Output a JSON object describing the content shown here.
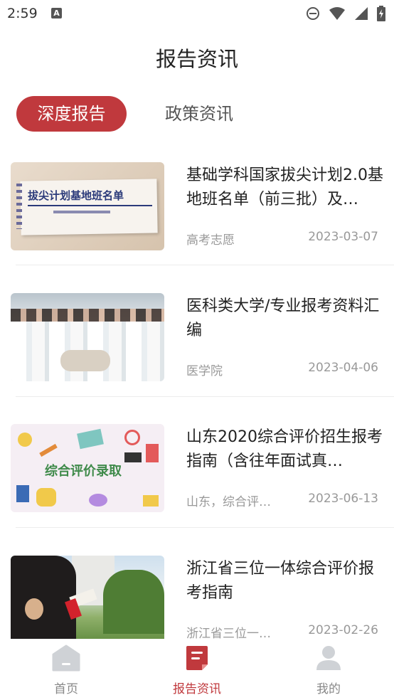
{
  "status_bar": {
    "time": "2:59",
    "notification_icon": "A"
  },
  "header": {
    "title": "报告资讯"
  },
  "tabs": [
    {
      "label": "深度报告",
      "active": true
    },
    {
      "label": "政策资讯",
      "active": false
    }
  ],
  "items": [
    {
      "title": "基础学科国家拔尖计划2.0基地班名单（前三批）及…",
      "tag": "高考志愿",
      "date": "2023-03-07",
      "thumb_caption": "拔尖计划基地班名单"
    },
    {
      "title": "医科类大学/专业报考资料汇编",
      "tag": "医学院",
      "date": "2023-04-06"
    },
    {
      "title": "山东2020综合评价招生报考指南（含往年面试真…",
      "tag": "山东，综合评…",
      "date": "2023-06-13",
      "thumb_caption": "综合评价录取"
    },
    {
      "title": "浙江省三位一体综合评价报考指南",
      "tag": "浙江省三位一…",
      "date": "2023-02-26"
    }
  ],
  "bottom_nav": [
    {
      "label": "首页",
      "icon": "home-icon",
      "active": false
    },
    {
      "label": "报告资讯",
      "icon": "report-icon",
      "active": true
    },
    {
      "label": "我的",
      "icon": "profile-icon",
      "active": false
    }
  ],
  "colors": {
    "accent": "#c0393d",
    "muted": "#999999"
  }
}
